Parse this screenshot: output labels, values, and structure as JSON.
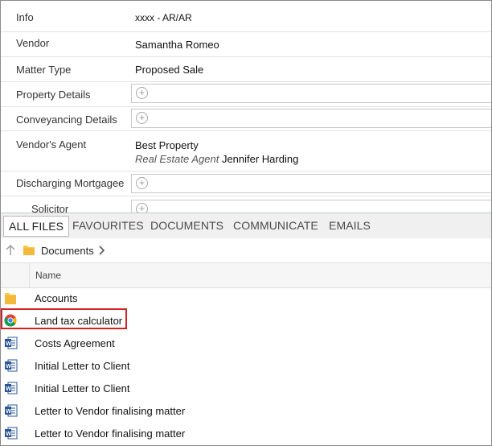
{
  "details": {
    "info": {
      "label": "Info",
      "value": "xxxx - AR/AR"
    },
    "vendor": {
      "label": "Vendor",
      "value": "Samantha Romeo"
    },
    "matter_type": {
      "label": "Matter Type",
      "value": "Proposed Sale"
    },
    "property_details": {
      "label": "Property Details"
    },
    "conveyancing_details": {
      "label": "Conveyancing Details"
    },
    "vendors_agent": {
      "label": "Vendor's Agent",
      "company": "Best Property",
      "role": "Real Estate Agent",
      "person": "Jennifer Harding"
    },
    "discharging_mortgagee": {
      "label": "Discharging Mortgagee"
    },
    "solicitor": {
      "label": "Solicitor"
    }
  },
  "tabs": [
    "ALL FILES",
    "FAVOURITES",
    "DOCUMENTS",
    "COMMUNICATE",
    "EMAILS"
  ],
  "active_tab": "ALL FILES",
  "breadcrumb": {
    "folder": "Documents"
  },
  "file_list": {
    "column_header": "Name",
    "rows": [
      {
        "name": "Accounts",
        "icon": "folder-icon"
      },
      {
        "name": "Land tax calculator",
        "icon": "chrome-icon",
        "highlighted": true
      },
      {
        "name": "Costs Agreement",
        "icon": "word-doc-icon"
      },
      {
        "name": "Initial Letter to Client",
        "icon": "word-doc-icon"
      },
      {
        "name": "Initial Letter to Client",
        "icon": "word-doc-icon"
      },
      {
        "name": "Letter to Vendor finalising matter",
        "icon": "word-doc-icon"
      },
      {
        "name": "Letter to Vendor finalising matter",
        "icon": "word-doc-icon"
      }
    ]
  },
  "colors": {
    "highlight": "#d42222",
    "folder": "#f7c948",
    "word": "#2b5797"
  }
}
